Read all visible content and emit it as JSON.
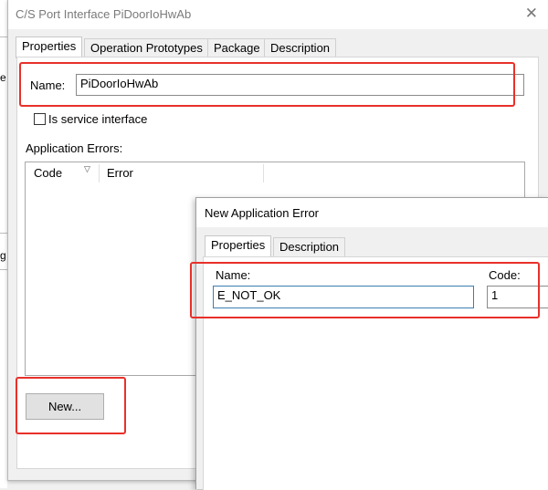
{
  "background": {
    "chars": [
      "e",
      "g"
    ]
  },
  "main_dialog": {
    "title": "C/S Port Interface PiDoorIoHwAb",
    "tabs": [
      "Properties",
      "Operation Prototypes",
      "Package",
      "Description"
    ],
    "name_label": "Name:",
    "name_value": "PiDoorIoHwAb",
    "service_checkbox_label": "Is service interface",
    "errors_label": "Application Errors:",
    "columns": [
      "Code",
      "Error"
    ],
    "new_button": "New...",
    "close_glyph": "✕",
    "sort_glyph": "▽"
  },
  "sub_dialog": {
    "title": "New Application Error",
    "tabs": [
      "Properties",
      "Description"
    ],
    "name_label": "Name:",
    "name_value": "E_NOT_OK",
    "code_label": "Code:",
    "code_value": "1"
  },
  "colors": {
    "highlight": "#e8302a",
    "focus_border": "#3c7fb1"
  }
}
